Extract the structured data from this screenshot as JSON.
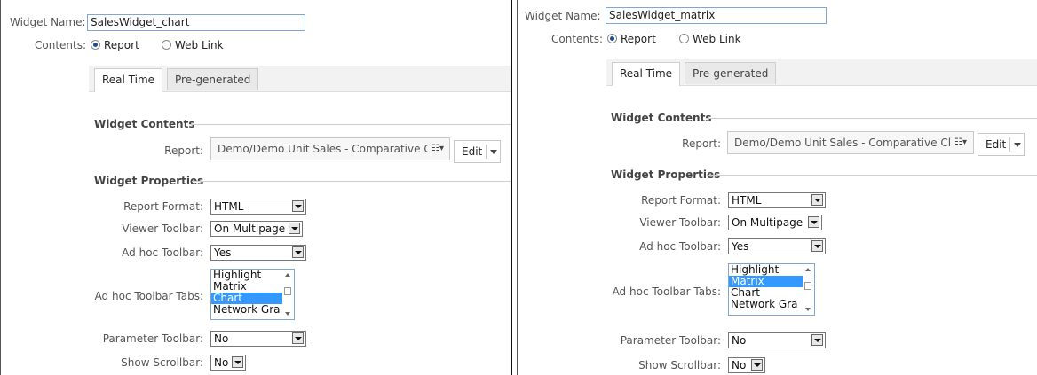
{
  "labels": {
    "widget_name": "Widget Name:",
    "contents": "Contents:",
    "report_radio": "Report",
    "weblink_radio": "Web Link",
    "tab_realtime": "Real Time",
    "tab_pregenerated": "Pre-generated",
    "widget_contents": "Widget Contents",
    "report": "Report:",
    "widget_properties": "Widget Properties",
    "report_format": "Report Format:",
    "viewer_toolbar": "Viewer Toolbar:",
    "adhoc_toolbar": "Ad hoc Toolbar:",
    "adhoc_tabs": "Ad hoc Toolbar Tabs:",
    "parameter_toolbar": "Parameter Toolbar:",
    "show_scrollbar": "Show Scrollbar:",
    "edit_button": "Edit"
  },
  "panels": [
    {
      "widget_name_value": "SalesWidget_chart",
      "contents_selected": "Report",
      "active_tab": "Real Time",
      "report_value": "Demo/Demo Unit Sales - Comparative Cl",
      "report_format": "HTML",
      "viewer_toolbar": "On Multipage",
      "adhoc_toolbar": "Yes",
      "adhoc_tabs_options": [
        "Highlight",
        "Matrix",
        "Chart",
        "Network Gra"
      ],
      "adhoc_tabs_selected": "Chart",
      "parameter_toolbar": "No",
      "show_scrollbar": "No"
    },
    {
      "widget_name_value": "SalesWidget_matrix",
      "contents_selected": "Report",
      "active_tab": "Real Time",
      "report_value": "Demo/Demo Unit Sales - Comparative Cl",
      "report_format": "HTML",
      "viewer_toolbar": "On Multipage",
      "adhoc_toolbar": "Yes",
      "adhoc_tabs_options": [
        "Highlight",
        "Matrix",
        "Chart",
        "Network Gra"
      ],
      "adhoc_tabs_selected": "Matrix",
      "parameter_toolbar": "No",
      "show_scrollbar": "No"
    }
  ]
}
